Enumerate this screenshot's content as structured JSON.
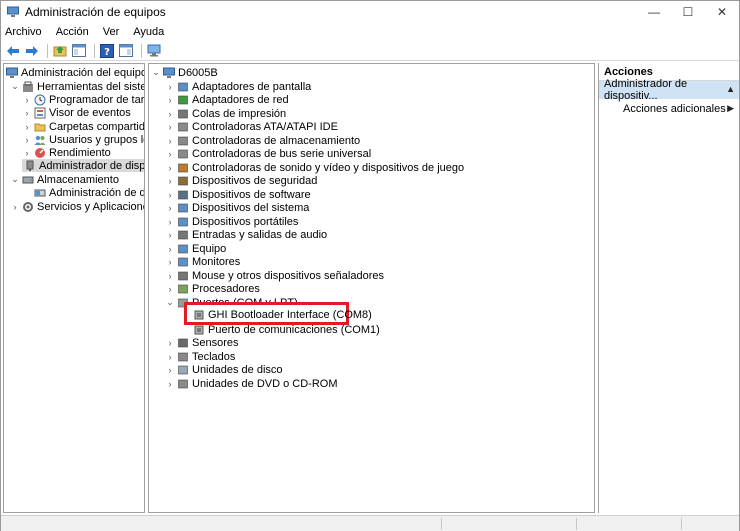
{
  "window": {
    "title": "Administración de equipos"
  },
  "menu": [
    "Archivo",
    "Acción",
    "Ver",
    "Ayuda"
  ],
  "window_buttons": {
    "minimize": "—",
    "maximize": "☐",
    "close": "✕"
  },
  "left_tree": [
    {
      "label": "Administración del equipo (loc",
      "expander": "",
      "icon": "computer-management-icon"
    },
    {
      "label": "Herramientas del sistema",
      "expander": "⌄",
      "icon": "tools-icon"
    },
    {
      "label": "Programador de tareas",
      "expander": "›",
      "icon": "clock-icon"
    },
    {
      "label": "Visor de eventos",
      "expander": "›",
      "icon": "event-viewer-icon"
    },
    {
      "label": "Carpetas compartidas",
      "expander": "›",
      "icon": "shared-folder-icon"
    },
    {
      "label": "Usuarios y grupos locale",
      "expander": "›",
      "icon": "users-icon"
    },
    {
      "label": "Rendimiento",
      "expander": "›",
      "icon": "performance-icon"
    },
    {
      "label": "Administrador de dispo",
      "expander": "",
      "icon": "device-manager-icon",
      "selected": true
    },
    {
      "label": "Almacenamiento",
      "expander": "⌄",
      "icon": "storage-icon"
    },
    {
      "label": "Administración de disco",
      "expander": "",
      "icon": "disk-management-icon"
    },
    {
      "label": "Servicios y Aplicaciones",
      "expander": "›",
      "icon": "services-icon"
    }
  ],
  "device_tree": {
    "root": "D6005B",
    "categories": [
      {
        "label": "Adaptadores de pantalla",
        "icon": "display-adapter-icon"
      },
      {
        "label": "Adaptadores de red",
        "icon": "network-adapter-icon"
      },
      {
        "label": "Colas de impresión",
        "icon": "printer-icon"
      },
      {
        "label": "Controladoras ATA/ATAPI IDE",
        "icon": "ide-controller-icon"
      },
      {
        "label": "Controladoras de almacenamiento",
        "icon": "storage-controller-icon"
      },
      {
        "label": "Controladoras de bus serie universal",
        "icon": "usb-icon"
      },
      {
        "label": "Controladoras de sonido y vídeo y dispositivos de juego",
        "icon": "sound-icon"
      },
      {
        "label": "Dispositivos de seguridad",
        "icon": "security-device-icon"
      },
      {
        "label": "Dispositivos de software",
        "icon": "software-device-icon"
      },
      {
        "label": "Dispositivos del sistema",
        "icon": "system-device-icon"
      },
      {
        "label": "Dispositivos portátiles",
        "icon": "portable-device-icon"
      },
      {
        "label": "Entradas y salidas de audio",
        "icon": "audio-io-icon"
      },
      {
        "label": "Equipo",
        "icon": "computer-icon"
      },
      {
        "label": "Monitores",
        "icon": "monitor-icon"
      },
      {
        "label": "Mouse y otros dispositivos señaladores",
        "icon": "mouse-icon"
      },
      {
        "label": "Procesadores",
        "icon": "processor-icon"
      },
      {
        "label": "Puertos (COM y LPT)",
        "icon": "port-icon",
        "expanded": true,
        "children": [
          {
            "label": "GHI Bootloader Interface (COM8)",
            "icon": "port-device-icon"
          },
          {
            "label": "Puerto de comunicaciones (COM1)",
            "icon": "port-device-icon"
          }
        ]
      },
      {
        "label": "Sensores",
        "icon": "sensor-icon"
      },
      {
        "label": "Teclados",
        "icon": "keyboard-icon"
      },
      {
        "label": "Unidades de disco",
        "icon": "disk-drive-icon"
      },
      {
        "label": "Unidades de DVD o CD-ROM",
        "icon": "dvd-icon"
      }
    ]
  },
  "actions": {
    "title": "Acciones",
    "section": "Administrador de dispositiv...",
    "items": [
      "Acciones adicionales"
    ]
  },
  "colors": {
    "highlight": "#e01b24",
    "selection": "#d9d9d9",
    "actions_header": "#cfe3f5"
  }
}
